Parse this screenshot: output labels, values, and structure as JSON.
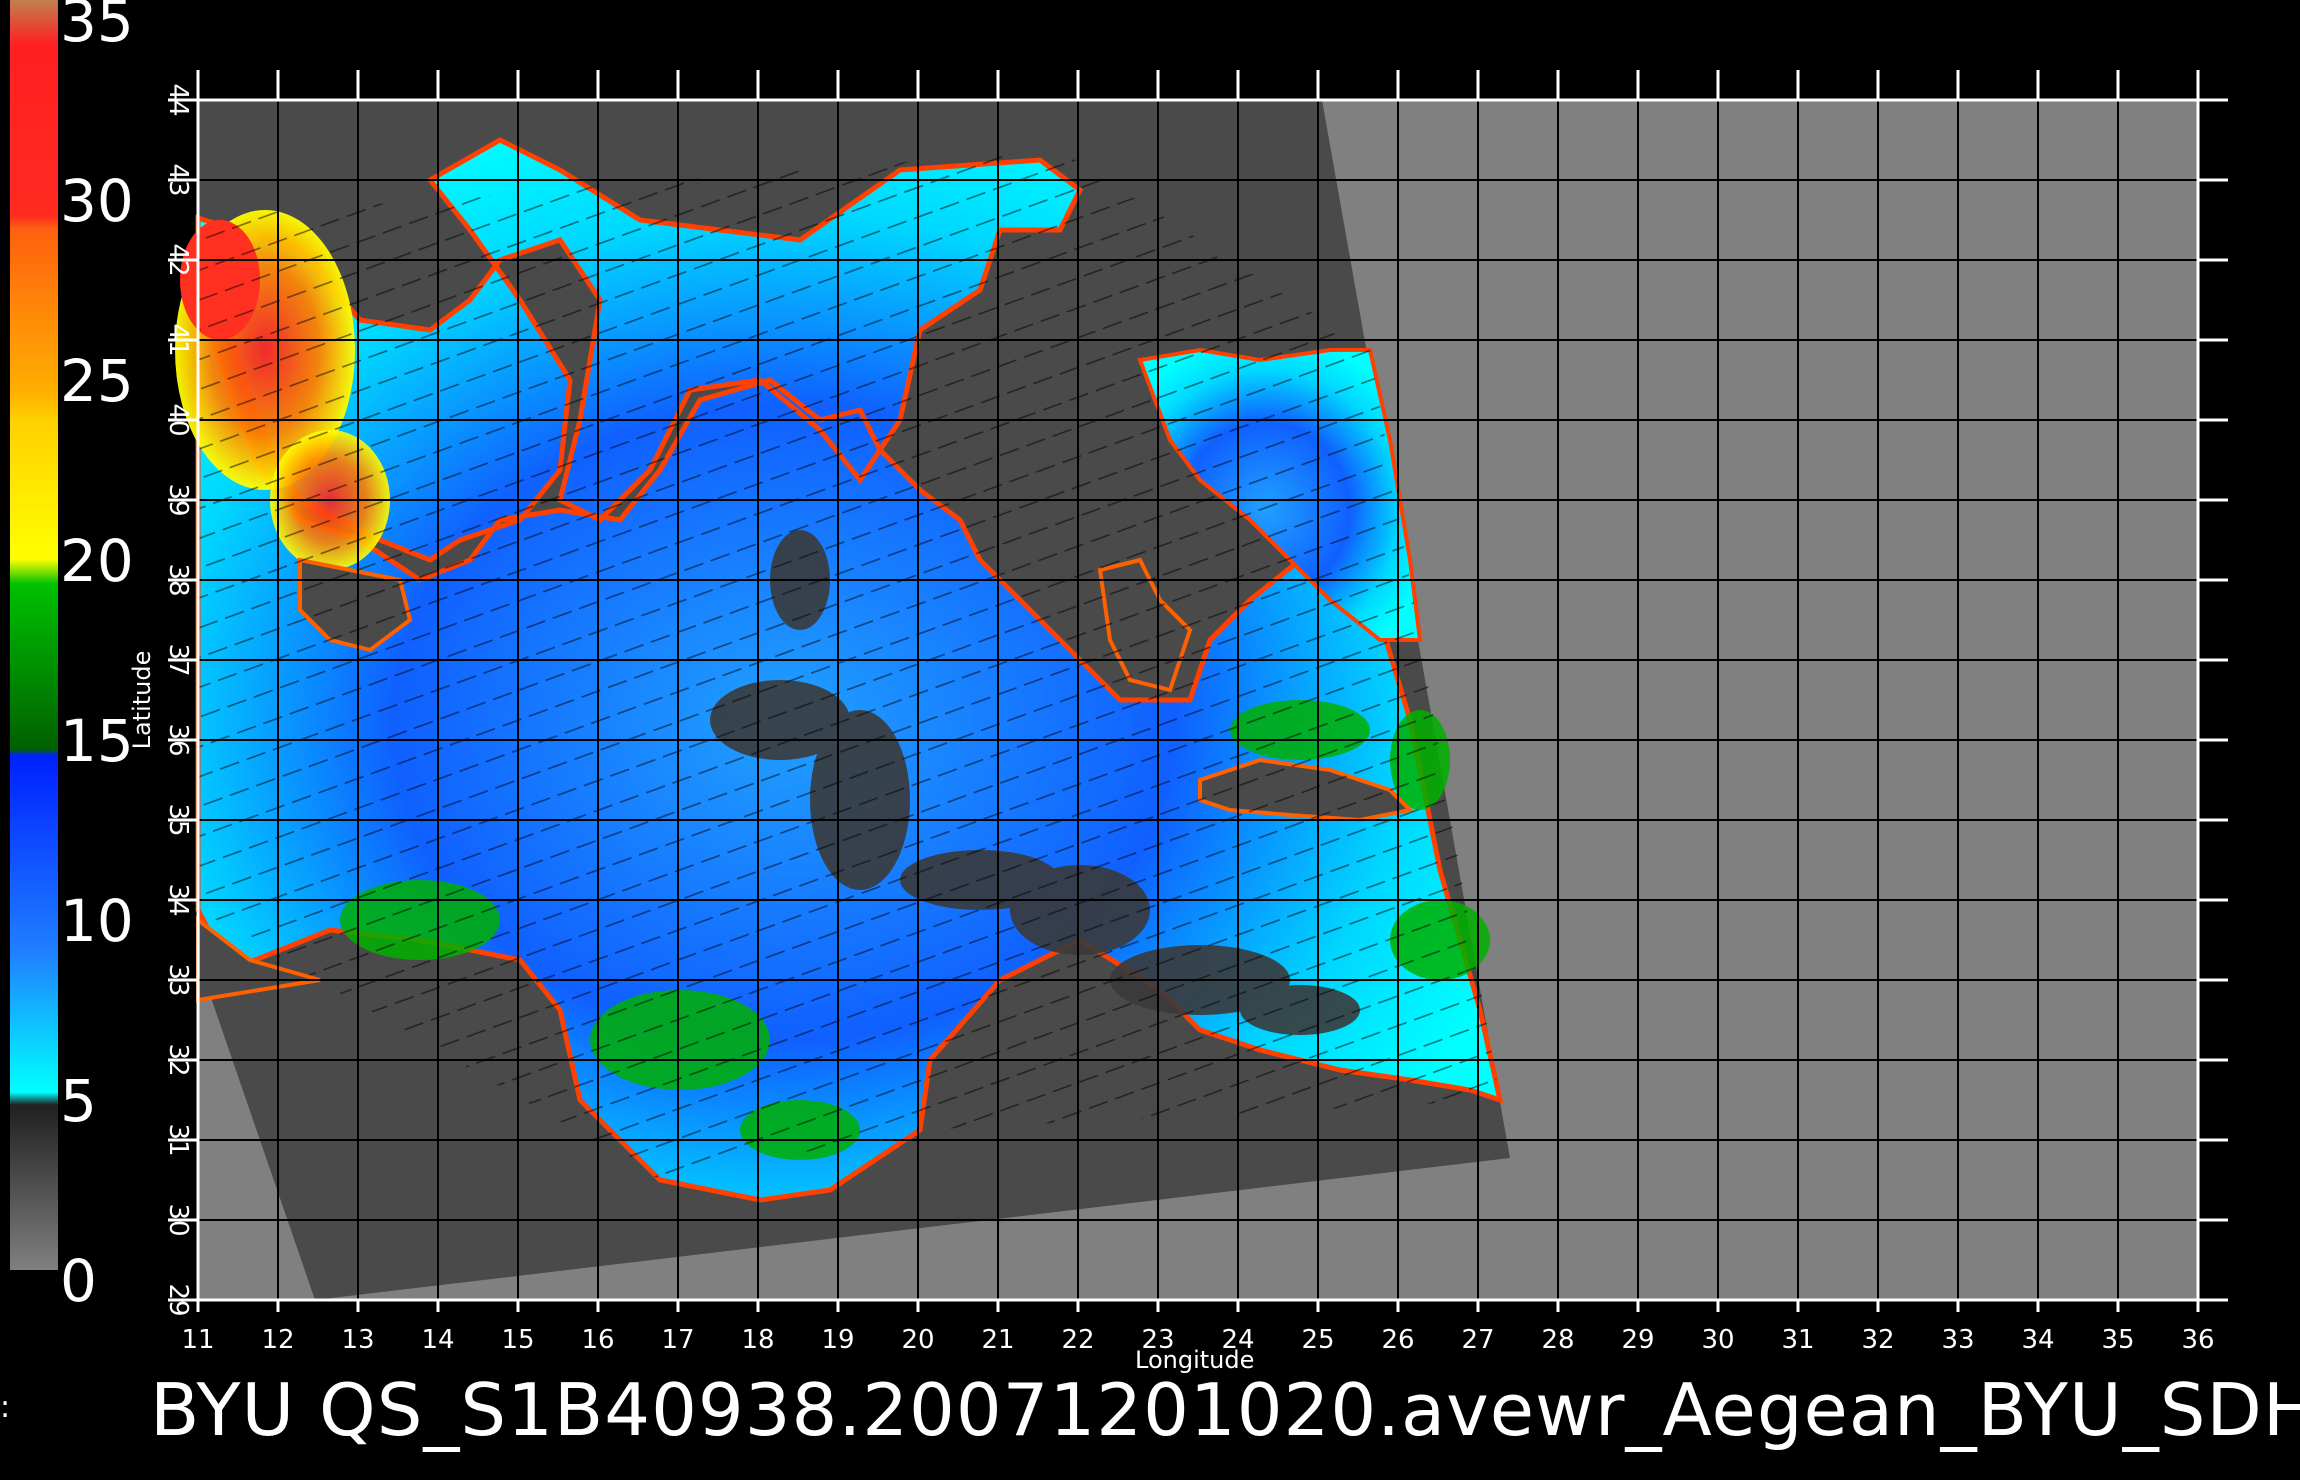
{
  "colorbar": {
    "labels": [
      "35",
      "30",
      "25",
      "20",
      "15",
      "10",
      "5",
      "0"
    ],
    "levels": [
      35,
      30,
      25,
      20,
      15,
      10,
      5,
      0
    ],
    "colors": {
      "brown": "#c0804f",
      "red": "#ff2020",
      "orange_red": "#ff6010",
      "orange": "#ffb000",
      "yellow": "#ffff00",
      "green": "#00c000",
      "dark_green": "#006000",
      "blue": "#0030ff",
      "sky_blue": "#20a0ff",
      "cyan": "#00ffff",
      "dark_grey": "#202020",
      "grey": "#808080"
    }
  },
  "map": {
    "background_color": "#808080",
    "swath_color": "#4a4a4a",
    "x_ticks": [
      "11",
      "12",
      "13",
      "14",
      "15",
      "16",
      "17",
      "18",
      "19",
      "20",
      "21",
      "22",
      "23",
      "24",
      "25",
      "26",
      "27",
      "28",
      "29",
      "30",
      "31",
      "32",
      "33",
      "34",
      "35",
      "36"
    ],
    "y_ticks": [
      "44",
      "43",
      "42",
      "41",
      "40",
      "39",
      "38",
      "37",
      "36",
      "35",
      "34",
      "33",
      "32",
      "31",
      "30",
      "29"
    ],
    "x_range": [
      11,
      36
    ],
    "y_range": [
      29,
      44
    ],
    "xlabel": "Longitude",
    "ylabel": "Latitude",
    "grid": true
  },
  "caption": "BYU  QS_S1B40938.20071201020.avewr_Aegean_BYU_SDH",
  "edge_mark": ":"
}
